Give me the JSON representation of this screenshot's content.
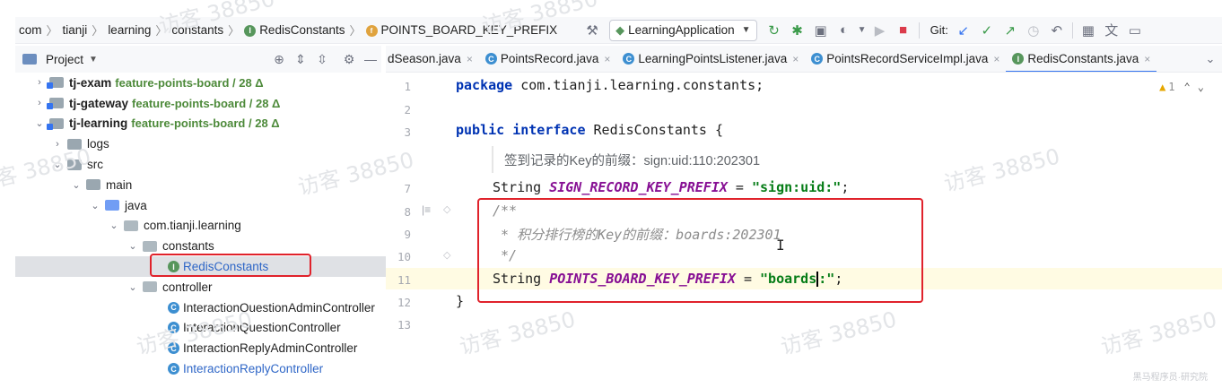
{
  "breadcrumb": [
    "com",
    "tianji",
    "learning",
    "constants",
    "RedisConstants",
    "POINTS_BOARD_KEY_PREFIX"
  ],
  "toolbar": {
    "run_config": "LearningApplication",
    "git_label": "Git:"
  },
  "project_panel": {
    "title": "Project",
    "tree": [
      {
        "label": "tj-exam",
        "branch": "feature-points-board / 28 Δ"
      },
      {
        "label": "tj-gateway",
        "branch": "feature-points-board / 28 Δ"
      },
      {
        "label": "tj-learning",
        "branch": "feature-points-board / 28 Δ"
      },
      {
        "label": "logs"
      },
      {
        "label": "src"
      },
      {
        "label": "main"
      },
      {
        "label": "java"
      },
      {
        "label": "com.tianji.learning"
      },
      {
        "label": "constants"
      },
      {
        "label": "RedisConstants"
      },
      {
        "label": "controller"
      },
      {
        "label": "InteractionQuestionAdminController"
      },
      {
        "label": "InteractionQuestionController"
      },
      {
        "label": "InteractionReplyAdminController"
      },
      {
        "label": "InteractionReplyController"
      }
    ]
  },
  "tabs": [
    {
      "label": "dSeason.java"
    },
    {
      "label": "PointsRecord.java"
    },
    {
      "label": "LearningPointsListener.java"
    },
    {
      "label": "PointsRecordServiceImpl.java"
    },
    {
      "label": "RedisConstants.java"
    }
  ],
  "editor": {
    "line_numbers": [
      "1",
      "2",
      "3",
      "7",
      "8",
      "9",
      "10",
      "11",
      "12",
      "13"
    ],
    "warning_count": "1",
    "inlay_comment": "签到记录的Key的前缀：sign:uid:110:202301",
    "code": {
      "l1_kw": "package",
      "l1_rest": " com.tianji.learning.constants;",
      "l3_kw": "public interface",
      "l3_rest": " RedisConstants {",
      "l7_type": "String ",
      "l7_const": "SIGN_RECORD_KEY_PREFIX",
      "l7_eq": " = ",
      "l7_str": "\"sign:uid:\"",
      "l7_end": ";",
      "l8": "/**",
      "l9": " * 积分排行榜的Key的前缀：boards:202301",
      "l10": " */",
      "l11_type": "String ",
      "l11_const": "POINTS_BOARD_KEY_PREFIX",
      "l11_eq": " = ",
      "l11_str_a": "\"boards",
      "l11_str_b": ":\"",
      "l11_end": ";",
      "l12": "}"
    }
  },
  "watermark": "访客 38850",
  "corner_watermark": "黑马程序员·研究院",
  "colors": {
    "highlight_box": "#e0222b",
    "accent": "#3574f0"
  }
}
